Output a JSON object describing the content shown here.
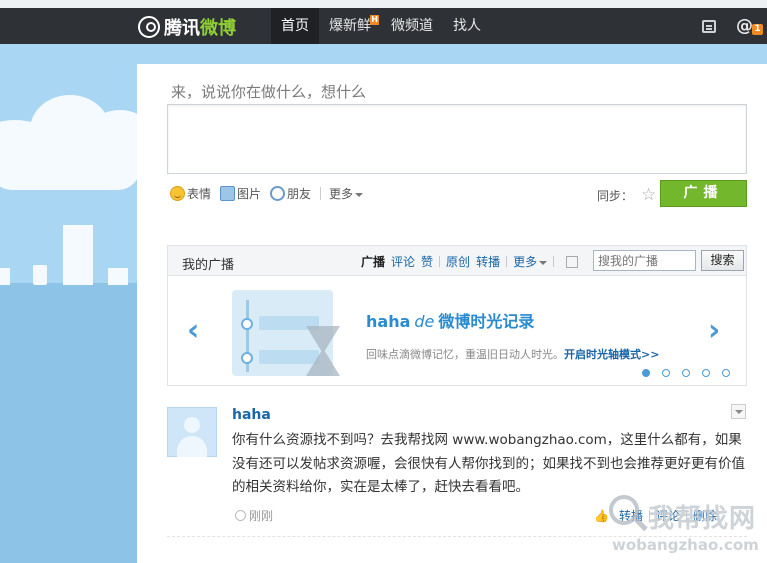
{
  "brand": {
    "logo_part1": "腾讯",
    "logo_part2": "微博"
  },
  "nav": {
    "items": [
      {
        "label": "首页"
      },
      {
        "label": "爆新鲜"
      },
      {
        "label": "微频道"
      },
      {
        "label": "找人"
      }
    ],
    "hot_badge": "H",
    "at_count": "1"
  },
  "composer": {
    "prompt": "来，说说你在做什么，想什么",
    "value": "",
    "tools": {
      "emoji": "表情",
      "image": "图片",
      "friends": "朋友",
      "more": "更多"
    },
    "sync_label": "同步：",
    "broadcast_button": "广播"
  },
  "my_broadcasts": {
    "title": "我的广播",
    "filters": [
      "广播",
      "评论",
      "赞",
      "原创",
      "转播",
      "更多"
    ],
    "search_placeholder": "搜我的广播",
    "search_button": "搜索",
    "banner": {
      "title_user": "haha",
      "title_de": "de",
      "title_main": "微博时光记录",
      "subtitle": "回味点滴微博记忆，重温旧日动人时光。",
      "link": "开启时光轴模式>>",
      "page_count": 5,
      "active_page": 1
    }
  },
  "feed": [
    {
      "author": "haha",
      "text": "你有什么资源找不到吗？去我帮找网 www.wobangzhao.com，这里什么都有，如果没有还可以发帖求资源喔，会很快有人帮你找到的；如果找不到也会推荐更好更有价值的相关资料给你，实在是太棒了，赶快去看看吧。",
      "time": "刚刚",
      "actions": [
        "转播",
        "评论",
        "删除"
      ]
    }
  ],
  "watermark": {
    "cn": "我帮找网",
    "url": "wobangzhao.com"
  },
  "colors": {
    "topbar": "#2e3136",
    "accent_green": "#73b72d",
    "link_blue": "#1a66a8",
    "sky": "#a9d6f2"
  }
}
